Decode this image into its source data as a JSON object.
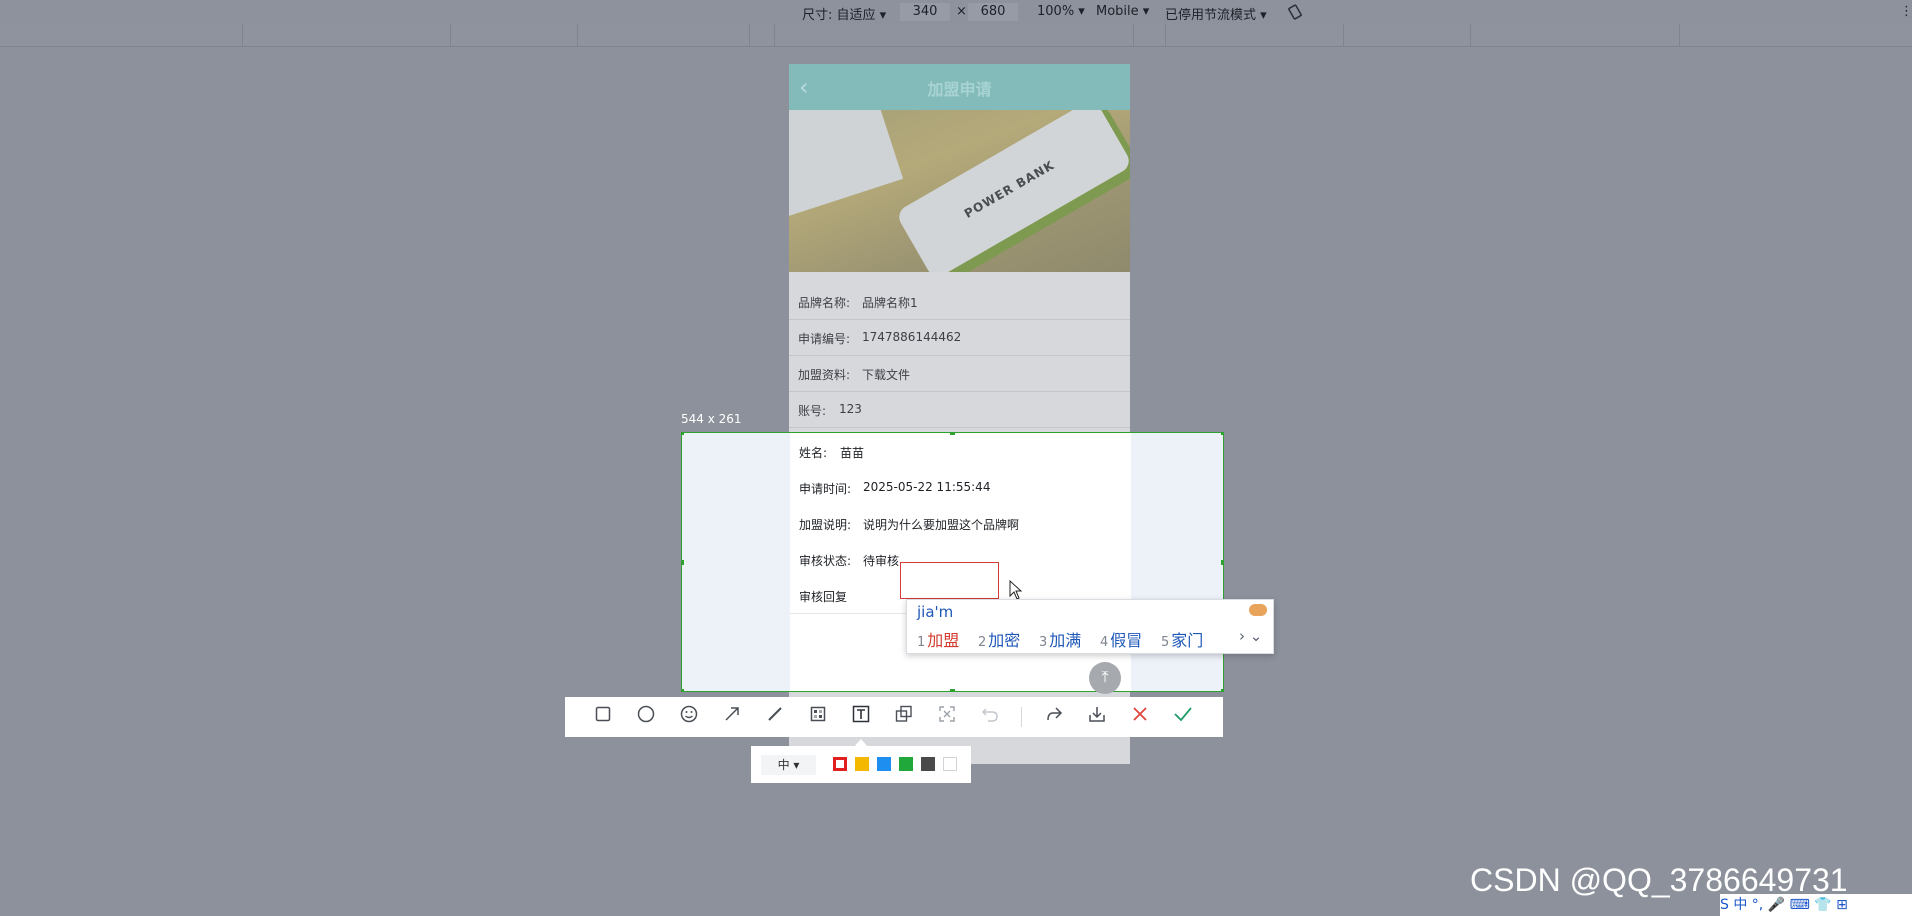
{
  "devtools": {
    "size_label": "尺寸: 自适应 ▾",
    "width": "340",
    "times": "×",
    "height": "680",
    "zoom": "100% ▾",
    "device": "Mobile ▾",
    "throttle": "已停用节流模式 ▾",
    "rotate_icon": "rotate-icon",
    "more_icon": "⋮"
  },
  "phone": {
    "header_title": "加盟申请",
    "hero_text": "POWER BANK",
    "rows_top": [
      {
        "label": "品牌名称:",
        "value": "品牌名称1"
      },
      {
        "label": "申请编号:",
        "value": "1747886144462"
      },
      {
        "label": "加盟资料:",
        "value": "下载文件"
      },
      {
        "label": "账号:",
        "value": "123"
      }
    ]
  },
  "selection": {
    "size": "544 x 261",
    "rows": [
      {
        "label": "姓名:",
        "value": "苗苗"
      },
      {
        "label": "申请时间:",
        "value": "2025-05-22 11:55:44"
      },
      {
        "label": "加盟说明:",
        "value": "说明为什么要加盟这个品牌啊"
      },
      {
        "label": "审核状态:",
        "value": "待审核"
      },
      {
        "label": "审核回复",
        "value": ""
      }
    ]
  },
  "ime": {
    "pinyin": "jia'm",
    "candidates": [
      {
        "n": "1",
        "text": "加盟"
      },
      {
        "n": "2",
        "text": "加密"
      },
      {
        "n": "3",
        "text": "加满"
      },
      {
        "n": "4",
        "text": "假冒"
      },
      {
        "n": "5",
        "text": "家门"
      }
    ],
    "more": "› ⌄"
  },
  "toolbar": {
    "tools": [
      "rectangle-icon",
      "ellipse-icon",
      "emoji-icon",
      "arrow-icon",
      "line-icon",
      "mosaic-icon",
      "text-icon",
      "pin-icon",
      "ocr-icon",
      "undo-icon",
      "share-icon",
      "save-icon",
      "close-icon",
      "confirm-icon"
    ]
  },
  "subpanel": {
    "size": "中 ▾",
    "colors": [
      "#e02020",
      "#f5b800",
      "#1e8ff0",
      "#21a83a",
      "#4a4a4a",
      "#ffffff"
    ]
  },
  "watermark": "CSDN @QQ_3786649731",
  "tray": "S 中 °, 🎤 ⌨ 👕 ⊞"
}
